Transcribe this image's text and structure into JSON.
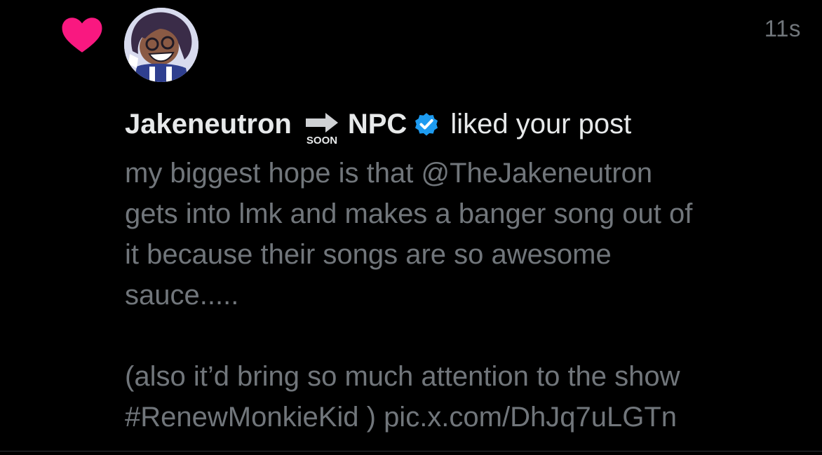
{
  "notification": {
    "timestamp": "11s",
    "user_name": "Jakeneutron",
    "soon_label": "SOON",
    "name_suffix": "NPC",
    "action": "liked your post",
    "post_lines": [
      "my biggest hope is that @TheJakeneutron",
      "gets into lmk and makes a banger song out of",
      "it because their songs are so awesome",
      "sauce.....",
      "(also it’d bring so much attention to the show",
      "#RenewMonkieKid ) pic.x.com/DhJq7uLGTn"
    ],
    "icons": {
      "like": "heart-icon",
      "soon": "soon-arrow-icon",
      "verified": "verified-badge-icon"
    },
    "colors": {
      "background": "#000000",
      "heart": "#f91880",
      "primary_text": "#e7e9ea",
      "secondary_text": "#71767b",
      "verified": "#1d9bf0"
    }
  }
}
